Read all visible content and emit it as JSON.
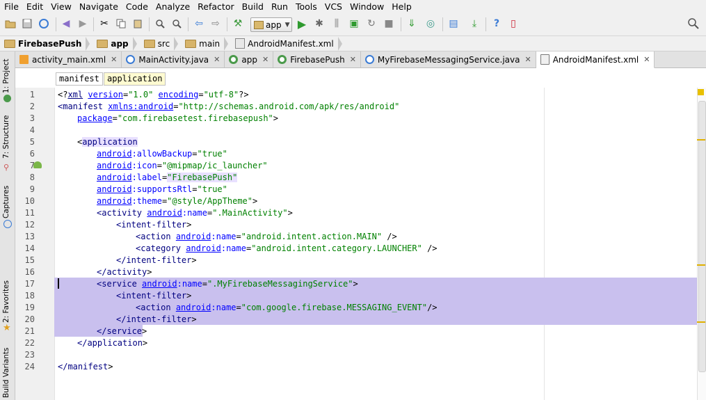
{
  "menu": [
    "File",
    "Edit",
    "View",
    "Navigate",
    "Code",
    "Analyze",
    "Refactor",
    "Build",
    "Run",
    "Tools",
    "VCS",
    "Window",
    "Help"
  ],
  "toolbar": {
    "run_config": "app",
    "icons": [
      "open-icon",
      "save-icon",
      "sync-icon",
      "undo-icon",
      "redo-icon",
      "cut-icon",
      "copy-icon",
      "paste-icon",
      "find-icon",
      "replace-icon",
      "back-icon",
      "forward-icon",
      "make-icon",
      "run-icon",
      "debug-icon",
      "attach-icon",
      "profile-icon",
      "rerun-icon",
      "stop-icon",
      "gradle-sync-icon",
      "avd-icon",
      "sdk-icon",
      "project-structure-icon",
      "help-icon",
      "device-icon",
      "search-icon"
    ]
  },
  "breadcrumbs": [
    "FirebasePush",
    "app",
    "src",
    "main",
    "AndroidManifest.xml"
  ],
  "tabs": [
    {
      "label": "activity_main.xml",
      "icon": "xml-file-icon",
      "active": false
    },
    {
      "label": "MainActivity.java",
      "icon": "java-class-icon",
      "active": false
    },
    {
      "label": "app",
      "icon": "module-icon",
      "active": false
    },
    {
      "label": "FirebasePush",
      "icon": "module-icon",
      "active": false
    },
    {
      "label": "MyFirebaseMessagingService.java",
      "icon": "java-class-icon",
      "active": false
    },
    {
      "label": "AndroidManifest.xml",
      "icon": "manifest-file-icon",
      "active": true
    }
  ],
  "sidebar": [
    "1: Project",
    "7: Structure",
    "Captures",
    "2: Favorites",
    "Build Variants"
  ],
  "xml_crumbs": [
    "manifest",
    "application"
  ],
  "line_numbers": [
    "1",
    "2",
    "3",
    "4",
    "5",
    "6",
    "7",
    "8",
    "9",
    "10",
    "11",
    "12",
    "13",
    "14",
    "15",
    "16",
    "17",
    "18",
    "19",
    "20",
    "21",
    "22",
    "23",
    "24"
  ],
  "code": {
    "l1": {
      "open": "<?",
      "kw": "xml",
      "a1": "version",
      "e1": "=",
      "v1": "\"1.0\"",
      "a2": "encoding",
      "e2": "=",
      "v2": "\"utf-8\"",
      "close": "?>"
    },
    "l2": {
      "tag": "<manifest",
      "a1": "xmlns:",
      "a1b": "android",
      "e1": "=",
      "v1": "\"http://schemas.android.com/apk/res/android\""
    },
    "l3": {
      "a1": "package",
      "e1": "=",
      "v1": "\"com.firebasetest.firebasepush\"",
      "close": ">"
    },
    "l5": {
      "tag": "application"
    },
    "l6": {
      "ns": "android",
      "attr": ":allowBackup",
      "eq": "=",
      "val": "\"true\""
    },
    "l7": {
      "ns": "android",
      "attr": ":icon",
      "eq": "=",
      "val": "\"@mipmap/ic_launcher\""
    },
    "l8": {
      "ns": "android",
      "attr": ":label",
      "eq": "=",
      "val": "\"FirebasePush\""
    },
    "l9": {
      "ns": "android",
      "attr": ":supportsRtl",
      "eq": "=",
      "val": "\"true\""
    },
    "l10": {
      "ns": "android",
      "attr": ":theme",
      "eq": "=",
      "val": "\"@style/AppTheme\"",
      "close": ">"
    },
    "l11": {
      "tag": "<activity",
      "ns": "android",
      "attr": ":name",
      "eq": "=",
      "val": "\".MainActivity\"",
      "close": ">"
    },
    "l12": {
      "tag": "<intent-filter",
      "close": ">"
    },
    "l13": {
      "tag": "<action",
      "ns": "android",
      "attr": ":name",
      "eq": "=",
      "val": "\"android.intent.action.MAIN\"",
      "close": " />"
    },
    "l14": {
      "tag": "<category",
      "ns": "android",
      "attr": ":name",
      "eq": "=",
      "val": "\"android.intent.category.LAUNCHER\"",
      "close": " />"
    },
    "l15": {
      "tag": "</intent-filter",
      "close": ">"
    },
    "l16": {
      "tag": "</activity",
      "close": ">"
    },
    "l17": {
      "tag": "<service",
      "ns": "android",
      "attr": ":name",
      "eq": "=",
      "val": "\".MyFirebaseMessagingService\"",
      "close": ">"
    },
    "l18": {
      "tag": "<intent-filter",
      "close": ">"
    },
    "l19": {
      "tag": "<action",
      "ns": "android",
      "attr": ":name",
      "eq": "=",
      "val": "\"com.google.firebase.MESSAGING_EVENT\"",
      "close": "/>"
    },
    "l20": {
      "tag": "</intent-filter",
      "close": ">"
    },
    "l21": {
      "tag": "</service",
      "close": ">"
    },
    "l22": {
      "tag": "</application",
      "close": ">"
    },
    "l24": {
      "tag": "</manifest",
      "close": ">"
    }
  },
  "colors": {
    "tag": "#000080",
    "attr": "#0000ff",
    "string": "#008000",
    "selection": "#c9c0ee"
  }
}
